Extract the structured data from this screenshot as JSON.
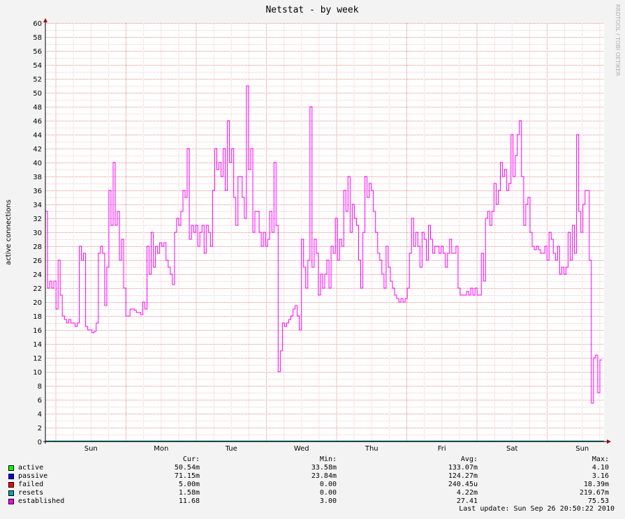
{
  "chart_data": {
    "type": "line",
    "title": "Netstat - by week",
    "ylabel": "active connections",
    "ylim": [
      0,
      60
    ],
    "ytick_step": 2,
    "grid": true,
    "x_categories": [
      "Sun",
      "Mon",
      "Tue",
      "Wed",
      "Thu",
      "Fri",
      "Sat",
      "Sun"
    ],
    "series": [
      {
        "name": "established",
        "color": "#ff00ff",
        "values": [
          33,
          22,
          23,
          22,
          23,
          19,
          26,
          21,
          18,
          17.5,
          17,
          17.5,
          17,
          17,
          16.5,
          17,
          28,
          26,
          27,
          16.5,
          16,
          16,
          15.6,
          15.8,
          17,
          27,
          28,
          27,
          19.5,
          25,
          36,
          31,
          40,
          31,
          33,
          26,
          29,
          22,
          18,
          18,
          19,
          19,
          18.8,
          18.5,
          18.5,
          18.2,
          20,
          19,
          28,
          24,
          30,
          25,
          28,
          27,
          28.5,
          28,
          28.5,
          26,
          25,
          24,
          22.5,
          30,
          32,
          31,
          33,
          36,
          35,
          42,
          29,
          31,
          30,
          31,
          28,
          30,
          31,
          27,
          31,
          30,
          28,
          36,
          42,
          39,
          40,
          38,
          42,
          36,
          46,
          40,
          42,
          35,
          31,
          38,
          38,
          35,
          32,
          51,
          39,
          42,
          30,
          33,
          33,
          30,
          28,
          30,
          28,
          29,
          33,
          30,
          40,
          31,
          10,
          13,
          17,
          16.5,
          17,
          17.5,
          18,
          19,
          19.5,
          18,
          16,
          29,
          25,
          22,
          26,
          48,
          25,
          29,
          27,
          21,
          24,
          22,
          24,
          26,
          22,
          28,
          27,
          32,
          26,
          29,
          28,
          36,
          33,
          38,
          30,
          34,
          32,
          31,
          26,
          22,
          30,
          38,
          35,
          37,
          36,
          33,
          30,
          27,
          26,
          24,
          22,
          28,
          25,
          23,
          22,
          21,
          20.5,
          20,
          20.5,
          20,
          20.5,
          22,
          27,
          32,
          28,
          30,
          28,
          25,
          30,
          29,
          26,
          31,
          29,
          27,
          28,
          28,
          27,
          28,
          27,
          25,
          27,
          29,
          27,
          27,
          28,
          22,
          21,
          21,
          21,
          21.5,
          21,
          22,
          21,
          22,
          21,
          21,
          27,
          23,
          32,
          33,
          31,
          33,
          37,
          34,
          36,
          40,
          38,
          39,
          36,
          37,
          44,
          38,
          41,
          44,
          46,
          38,
          31,
          34,
          35,
          30,
          28,
          27.5,
          28,
          27.5,
          27,
          27,
          28,
          26,
          30,
          29,
          27,
          26,
          28,
          24,
          25,
          24,
          25,
          30,
          26,
          31,
          27,
          44,
          33,
          30,
          34,
          36,
          36,
          26,
          5.5,
          12,
          12.4,
          7,
          11.7,
          11.7
        ]
      }
    ],
    "legend": {
      "headers": {
        "cur": "Cur:",
        "min": "Min:",
        "avg": "Avg:",
        "max": "Max:"
      },
      "items": [
        {
          "name": "active",
          "color": "#00ff00",
          "cur": "50.54m",
          "min": "33.58m",
          "avg": "133.07m",
          "max": "4.10"
        },
        {
          "name": "passive",
          "color": "#0000ff",
          "cur": "71.15m",
          "min": "23.84m",
          "avg": "124.27m",
          "max": "3.16"
        },
        {
          "name": "failed",
          "color": "#ff0000",
          "cur": "5.00m",
          "min": "0.00",
          "avg": "240.45u",
          "max": "18.39m"
        },
        {
          "name": "resets",
          "color": "#00aaaa",
          "cur": "1.58m",
          "min": "0.00",
          "avg": "4.22m",
          "max": "219.67m"
        },
        {
          "name": "established",
          "color": "#ff00ff",
          "cur": "11.68",
          "min": "3.00",
          "avg": "27.41",
          "max": "75.53"
        }
      ]
    },
    "watermark": "RRDTOOL / TOBI OETIKER",
    "last_update": "Last update: Sun Sep 26 20:50:22 2010"
  }
}
